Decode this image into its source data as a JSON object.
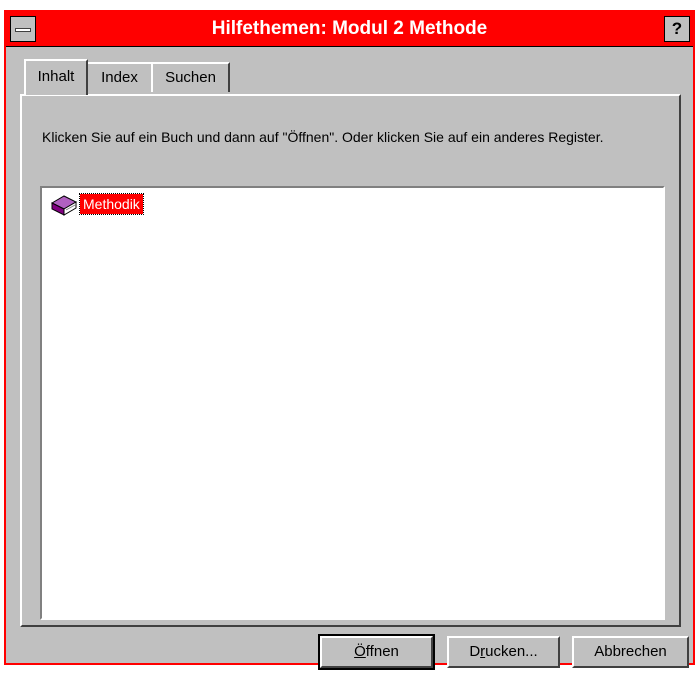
{
  "window": {
    "title": "Hilfethemen: Modul 2 Methode",
    "help_glyph": "?"
  },
  "tabs": [
    {
      "label": "Inhalt",
      "active": true
    },
    {
      "label": "Index",
      "active": false
    },
    {
      "label": "Suchen",
      "active": false
    }
  ],
  "contents": {
    "instruction": "Klicken Sie auf ein Buch und dann auf \"Öffnen\". Oder klicken Sie auf ein anderes Register.",
    "items": [
      {
        "label": "Methodik",
        "icon": "book-icon",
        "selected": true
      }
    ]
  },
  "buttons": {
    "open": {
      "pre": "",
      "accel": "Ö",
      "post": "ffnen"
    },
    "print": {
      "pre": "D",
      "accel": "r",
      "post": "ucken..."
    },
    "cancel": {
      "label": "Abbrechen"
    }
  },
  "colors": {
    "titlebar": "#ff0000",
    "face": "#c0c0c0",
    "selection": "#ff0000",
    "book": "#800080"
  }
}
